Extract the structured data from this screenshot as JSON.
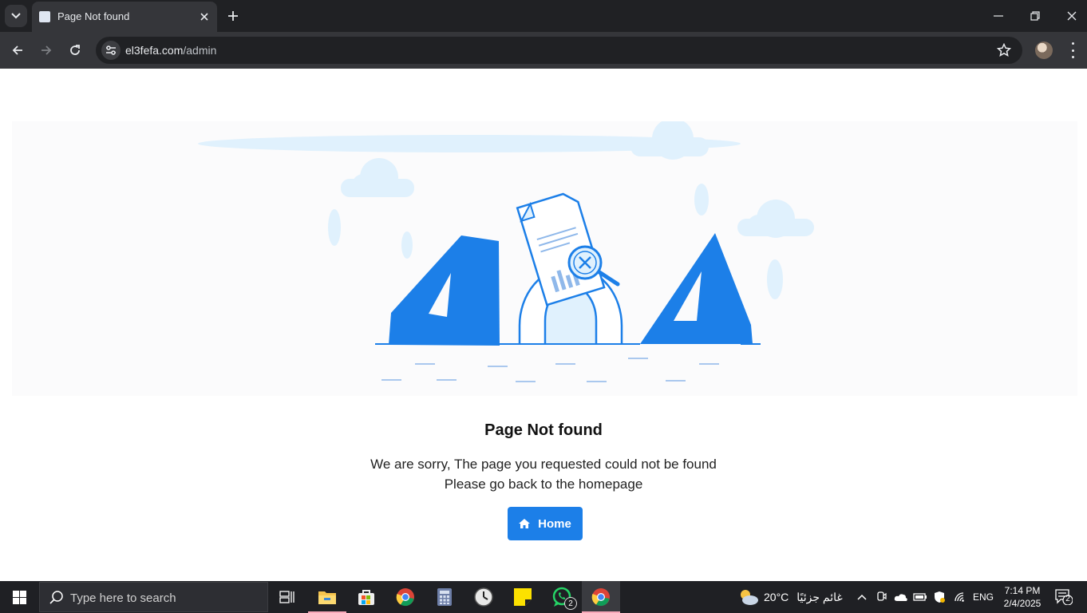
{
  "browser": {
    "tab_title": "Page Not found",
    "url_host": "el3fefa.com",
    "url_path": "/admin"
  },
  "page": {
    "illustration_text": "404",
    "heading": "Page Not found",
    "message_line1": "We are sorry, The page you requested could not be found",
    "message_line2": "Please go back to the homepage",
    "home_button": "Home",
    "accent_color": "#1c7fe8"
  },
  "taskbar": {
    "search_placeholder": "Type here to search",
    "apps": [
      "file-explorer",
      "microsoft-store",
      "chrome",
      "calculator",
      "clock",
      "sticky-notes",
      "whatsapp",
      "chrome"
    ],
    "whatsapp_badge": "2",
    "weather_temp": "20°C",
    "weather_text": "غائم جزئيًا",
    "language": "ENG",
    "time": "7:14 PM",
    "date": "2/4/2025",
    "notification_count": "2"
  }
}
